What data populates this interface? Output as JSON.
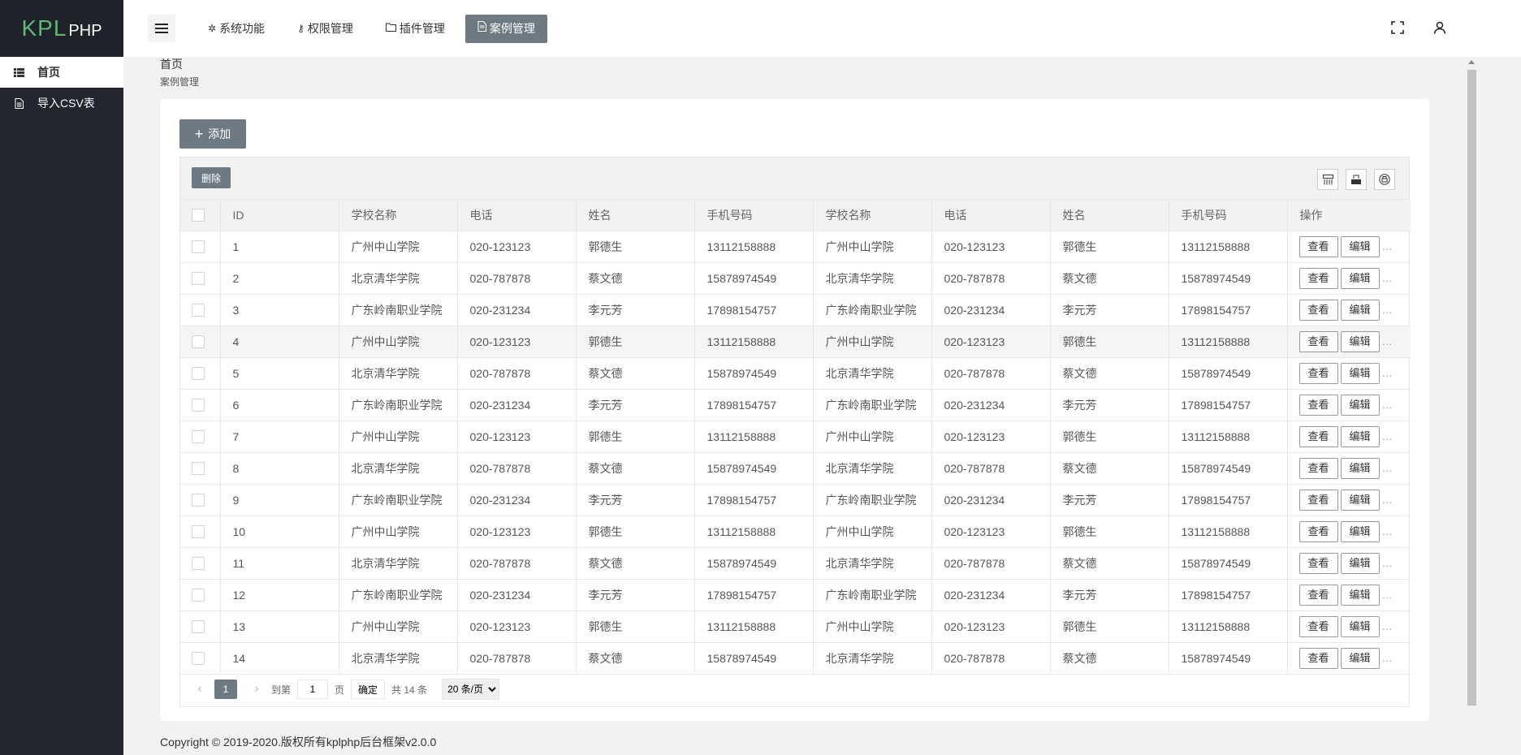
{
  "logo": {
    "kpl": "KPL",
    "php": "PHP"
  },
  "sidebar": {
    "items": [
      {
        "label": "首页",
        "icon": "list-icon",
        "active": true
      },
      {
        "label": "导入CSV表",
        "icon": "document-icon",
        "active": false
      }
    ]
  },
  "header": {
    "tabs": [
      {
        "label": "系统功能",
        "icon": "gear-icon"
      },
      {
        "label": "权限管理",
        "icon": "key-icon"
      },
      {
        "label": "插件管理",
        "icon": "folder-icon"
      },
      {
        "label": "案例管理",
        "icon": "document-icon",
        "active": true
      }
    ],
    "right_icons": [
      "fullscreen-icon",
      "user-icon"
    ]
  },
  "breadcrumb": {
    "level1": "首页",
    "level2": "案例管理"
  },
  "toolbar": {
    "add_label": "添加",
    "delete_label": "删除",
    "tool_icons": [
      "columns-icon",
      "export-icon",
      "print-icon"
    ]
  },
  "table": {
    "headers": [
      "ID",
      "学校名称",
      "电话",
      "姓名",
      "手机号码",
      "学校名称",
      "电话",
      "姓名",
      "手机号码",
      "操作"
    ],
    "view_label": "查看",
    "edit_label": "编辑",
    "more_label": "…",
    "rows": [
      [
        "1",
        "广州中山学院",
        "020-123123",
        "郭德生",
        "13112158888",
        "广州中山学院",
        "020-123123",
        "郭德生",
        "13112158888"
      ],
      [
        "2",
        "北京清华学院",
        "020-787878",
        "蔡文德",
        "15878974549",
        "北京清华学院",
        "020-787878",
        "蔡文德",
        "15878974549"
      ],
      [
        "3",
        "广东岭南职业学院",
        "020-231234",
        "李元芳",
        "17898154757",
        "广东岭南职业学院",
        "020-231234",
        "李元芳",
        "17898154757"
      ],
      [
        "4",
        "广州中山学院",
        "020-123123",
        "郭德生",
        "13112158888",
        "广州中山学院",
        "020-123123",
        "郭德生",
        "13112158888"
      ],
      [
        "5",
        "北京清华学院",
        "020-787878",
        "蔡文德",
        "15878974549",
        "北京清华学院",
        "020-787878",
        "蔡文德",
        "15878974549"
      ],
      [
        "6",
        "广东岭南职业学院",
        "020-231234",
        "李元芳",
        "17898154757",
        "广东岭南职业学院",
        "020-231234",
        "李元芳",
        "17898154757"
      ],
      [
        "7",
        "广州中山学院",
        "020-123123",
        "郭德生",
        "13112158888",
        "广州中山学院",
        "020-123123",
        "郭德生",
        "13112158888"
      ],
      [
        "8",
        "北京清华学院",
        "020-787878",
        "蔡文德",
        "15878974549",
        "北京清华学院",
        "020-787878",
        "蔡文德",
        "15878974549"
      ],
      [
        "9",
        "广东岭南职业学院",
        "020-231234",
        "李元芳",
        "17898154757",
        "广东岭南职业学院",
        "020-231234",
        "李元芳",
        "17898154757"
      ],
      [
        "10",
        "广州中山学院",
        "020-123123",
        "郭德生",
        "13112158888",
        "广州中山学院",
        "020-123123",
        "郭德生",
        "13112158888"
      ],
      [
        "11",
        "北京清华学院",
        "020-787878",
        "蔡文德",
        "15878974549",
        "北京清华学院",
        "020-787878",
        "蔡文德",
        "15878974549"
      ],
      [
        "12",
        "广东岭南职业学院",
        "020-231234",
        "李元芳",
        "17898154757",
        "广东岭南职业学院",
        "020-231234",
        "李元芳",
        "17898154757"
      ],
      [
        "13",
        "广州中山学院",
        "020-123123",
        "郭德生",
        "13112158888",
        "广州中山学院",
        "020-123123",
        "郭德生",
        "13112158888"
      ],
      [
        "14",
        "北京清华学院",
        "020-787878",
        "蔡文德",
        "15878974549",
        "北京清华学院",
        "020-787878",
        "蔡文德",
        "15878974549"
      ]
    ],
    "highlighted_row": 4
  },
  "pager": {
    "prev": "‹",
    "current": "1",
    "next": "›",
    "goto_label": "到第",
    "goto_value": "1",
    "page_label": "页",
    "confirm_label": "确定",
    "total_label": "共 14 条",
    "page_size": "20 条/页"
  },
  "footer": {
    "copyright": "Copyright © 2019-2020.版权所有kplphp后台框架v2.0.0"
  },
  "colors": {
    "accent": "#6d7a83",
    "sidebar_bg": "#23262e",
    "logo_green": "#5fb878"
  }
}
